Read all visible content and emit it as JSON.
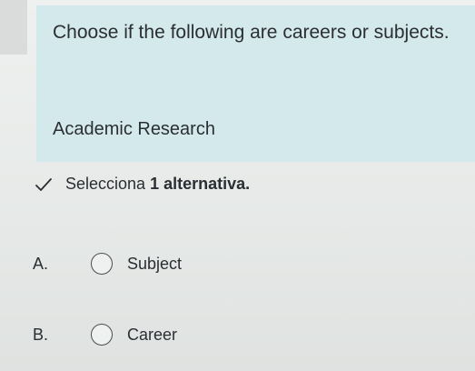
{
  "question": {
    "title": "Choose if the following are careers or subjects.",
    "prompt": "Academic Research"
  },
  "instruction": {
    "prefix": "Selecciona ",
    "count": "1",
    "suffix": " alternativa.",
    "icon": "check-icon"
  },
  "options": [
    {
      "letter": "A.",
      "label": "Subject",
      "selected": false
    },
    {
      "letter": "B.",
      "label": "Career",
      "selected": false
    }
  ]
}
